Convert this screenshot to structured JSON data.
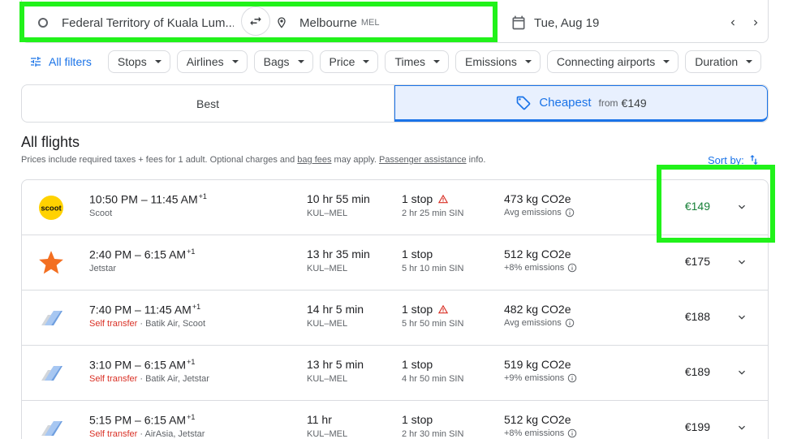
{
  "search": {
    "origin": "Federal Territory of Kuala Lum...",
    "destination": "Melbourne",
    "destination_code": "MEL",
    "date": "Tue, Aug 19"
  },
  "filters": {
    "all_filters_label": "All filters",
    "chips": [
      "Stops",
      "Airlines",
      "Bags",
      "Price",
      "Times",
      "Emissions",
      "Connecting airports",
      "Duration"
    ]
  },
  "tabs": {
    "best_label": "Best",
    "cheapest_label": "Cheapest",
    "cheapest_from_label": "from",
    "cheapest_price": "€149"
  },
  "section": {
    "title": "All flights",
    "note_prefix": "Prices include required taxes + fees for 1 adult. Optional charges and ",
    "note_bag_fees": "bag fees",
    "note_middle": " may apply. ",
    "note_assistance": "Passenger assistance",
    "note_suffix": " info.",
    "sort_label": "Sort by:"
  },
  "flights": [
    {
      "depart": "10:50 PM",
      "arrive": "11:45 AM",
      "day_offset": "+1",
      "self_transfer": "",
      "airline": "Scoot",
      "duration": "10 hr 55 min",
      "route": "KUL–MEL",
      "stops": "1 stop",
      "warning": true,
      "layover": "2 hr 25 min SIN",
      "emissions": "473 kg CO2e",
      "emissions_note": "Avg emissions",
      "price": "€149",
      "logo": "scoot-logo"
    },
    {
      "depart": "2:40 PM",
      "arrive": "6:15 AM",
      "day_offset": "+1",
      "self_transfer": "",
      "airline": "Jetstar",
      "duration": "13 hr 35 min",
      "route": "KUL–MEL",
      "stops": "1 stop",
      "warning": false,
      "layover": "5 hr 10 min SIN",
      "emissions": "512 kg CO2e",
      "emissions_note": "+8% emissions",
      "price": "€175",
      "logo": "jetstar-logo"
    },
    {
      "depart": "7:40 PM",
      "arrive": "11:45 AM",
      "day_offset": "+1",
      "self_transfer": "Self transfer",
      "airline": " · Batik Air, Scoot",
      "duration": "14 hr 5 min",
      "route": "KUL–MEL",
      "stops": "1 stop",
      "warning": true,
      "layover": "5 hr 50 min SIN",
      "emissions": "482 kg CO2e",
      "emissions_note": "Avg emissions",
      "price": "€188",
      "logo": "multi-airline-logo"
    },
    {
      "depart": "3:10 PM",
      "arrive": "6:15 AM",
      "day_offset": "+1",
      "self_transfer": "Self transfer",
      "airline": " · Batik Air, Jetstar",
      "duration": "13 hr 5 min",
      "route": "KUL–MEL",
      "stops": "1 stop",
      "warning": false,
      "layover": "4 hr 50 min SIN",
      "emissions": "519 kg CO2e",
      "emissions_note": "+9% emissions",
      "price": "€189",
      "logo": "multi-airline-logo"
    },
    {
      "depart": "5:15 PM",
      "arrive": "6:15 AM",
      "day_offset": "+1",
      "self_transfer": "Self transfer",
      "airline": " · AirAsia, Jetstar",
      "duration": "11 hr",
      "route": "KUL–MEL",
      "stops": "1 stop",
      "warning": false,
      "layover": "2 hr 30 min SIN",
      "emissions": "512 kg CO2e",
      "emissions_note": "+8% emissions",
      "price": "€199",
      "logo": "multi-airline-logo"
    }
  ],
  "colors": {
    "accent": "#1a73e8",
    "cheap_price": "#188038",
    "self_transfer": "#d93025",
    "highlight": "#21f21a",
    "warning": "#d93025"
  }
}
